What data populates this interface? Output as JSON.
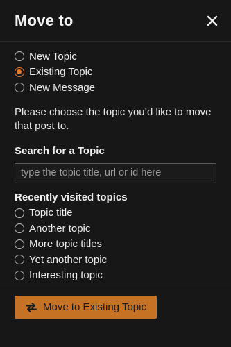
{
  "header": {
    "title": "Move to",
    "close_icon": "close-icon"
  },
  "mode_options": [
    {
      "label": "New Topic",
      "checked": false
    },
    {
      "label": "Existing Topic",
      "checked": true
    },
    {
      "label": "New Message",
      "checked": false
    }
  ],
  "instructions": "Please choose the topic you’d like to move that post to.",
  "search": {
    "label": "Search for a Topic",
    "placeholder": "type the topic title, url or id here",
    "value": ""
  },
  "recent": {
    "label": "Recently visited topics",
    "topics": [
      {
        "label": "Topic title",
        "checked": false
      },
      {
        "label": "Another topic",
        "checked": false
      },
      {
        "label": "More topic titles",
        "checked": false
      },
      {
        "label": "Yet another topic",
        "checked": false
      },
      {
        "label": "Interesting topic",
        "checked": false
      }
    ]
  },
  "footer": {
    "button_label": "Move to Existing Topic",
    "button_icon": "exchange-arrows-icon"
  },
  "colors": {
    "background": "#171717",
    "accent": "#e07c2c",
    "button": "#c57225"
  }
}
